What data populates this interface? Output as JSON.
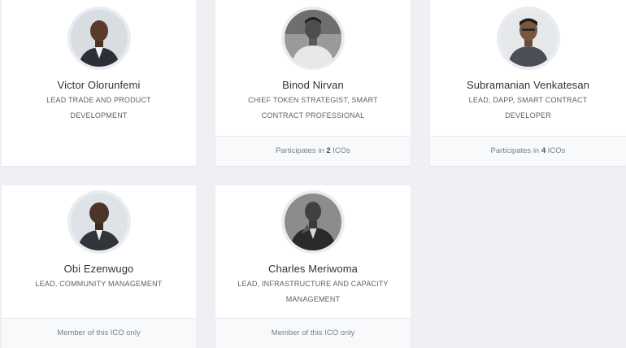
{
  "team": [
    {
      "name": "Victor Olorunfemi",
      "role": "LEAD TRADE AND PRODUCT DEVELOPMENT",
      "footer": null
    },
    {
      "name": "Binod Nirvan",
      "role": "CHIEF TOKEN STRATEGIST, SMART CONTRACT PROFESSIONAL",
      "footer": {
        "prefix": "Participates in ",
        "count": "2",
        "suffix": " ICOs"
      }
    },
    {
      "name": "Subramanian Venkatesan",
      "role": "LEAD, DAPP, SMART CONTRACT DEVELOPER",
      "footer": {
        "prefix": "Participates in ",
        "count": "4",
        "suffix": " ICOs"
      }
    },
    {
      "name": "Obi Ezenwugo",
      "role": "LEAD, COMMUNITY MANAGEMENT",
      "footer": {
        "text": "Member of this ICO only"
      }
    },
    {
      "name": "Charles Meriwoma",
      "role": "LEAD, INFRASTRUCTURE AND CAPACITY MANAGEMENT",
      "footer": {
        "text": "Member of this ICO only"
      }
    }
  ],
  "icons": {
    "avatar": "person-photo"
  },
  "colors": {
    "background": "#eef0f3",
    "card": "#ffffff",
    "footer": "#f7f9fb",
    "name_text": "#2f3338",
    "role_text": "#5b6168"
  }
}
